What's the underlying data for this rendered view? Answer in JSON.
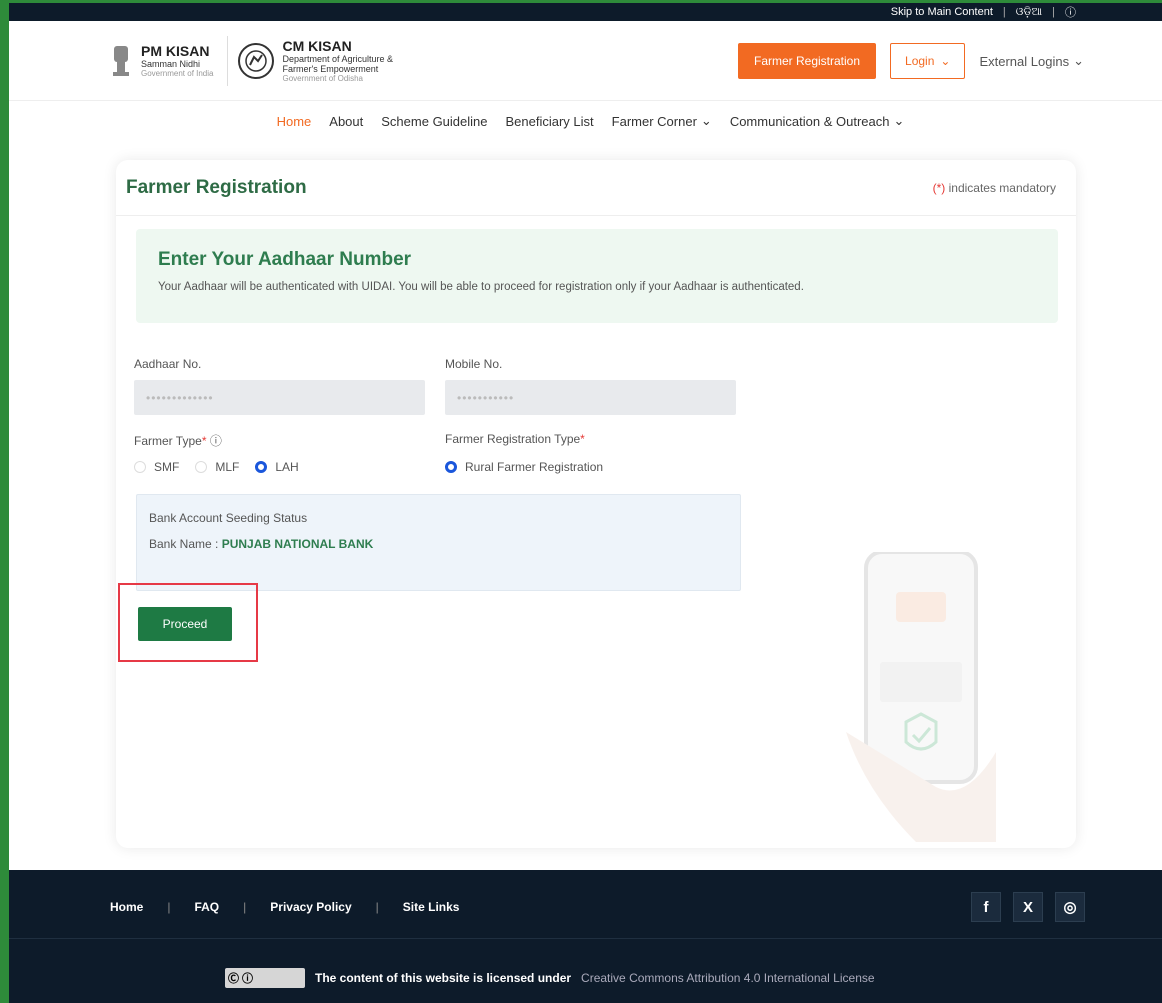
{
  "topbar": {
    "skip": "Skip to Main Content",
    "lang": "ଓଡ଼ିଆ"
  },
  "header": {
    "pm": {
      "title": "PM KISAN",
      "sub": "Samman Nidhi",
      "gov": "Government of India"
    },
    "cm": {
      "title": "CM KISAN",
      "dept": "Department of Agriculture &",
      "dept2": "Farmer's Empowerment",
      "gov": "Government of Odisha"
    },
    "register_label": "Farmer Registration",
    "login_label": "Login",
    "external_label": "External Logins"
  },
  "nav": [
    "Home",
    "About",
    "Scheme Guideline",
    "Beneficiary List",
    "Farmer Corner",
    "Communication & Outreach"
  ],
  "card": {
    "title": "Farmer Registration",
    "mandatory_mark": "(*)",
    "mandatory_text": "indicates mandatory",
    "alert_title": "Enter Your Aadhaar Number",
    "alert_text": "Your Aadhaar will be authenticated with UIDAI. You will be able to proceed for registration only if your Aadhaar is authenticated."
  },
  "form": {
    "aadhaar_label": "Aadhaar No.",
    "mobile_label": "Mobile No.",
    "farmer_type_label": "Farmer Type",
    "farmer_types": [
      "SMF",
      "MLF",
      "LAH"
    ],
    "reg_type_label": "Farmer Registration Type",
    "reg_type_option": "Rural Farmer Registration",
    "bank_status": "Bank Account Seeding Status",
    "bank_name_label": "Bank Name :",
    "bank_name": "PUNJAB NATIONAL BANK",
    "proceed_label": "Proceed"
  },
  "footer": {
    "links": [
      "Home",
      "FAQ",
      "Privacy Policy",
      "Site Links"
    ],
    "license_text": "The content of this website is licensed under",
    "license_link": "Creative Commons Attribution 4.0 International License"
  },
  "colors": {
    "accent": "#f26a22",
    "green": "#1e7a44",
    "footer": "#0d1b2a"
  }
}
